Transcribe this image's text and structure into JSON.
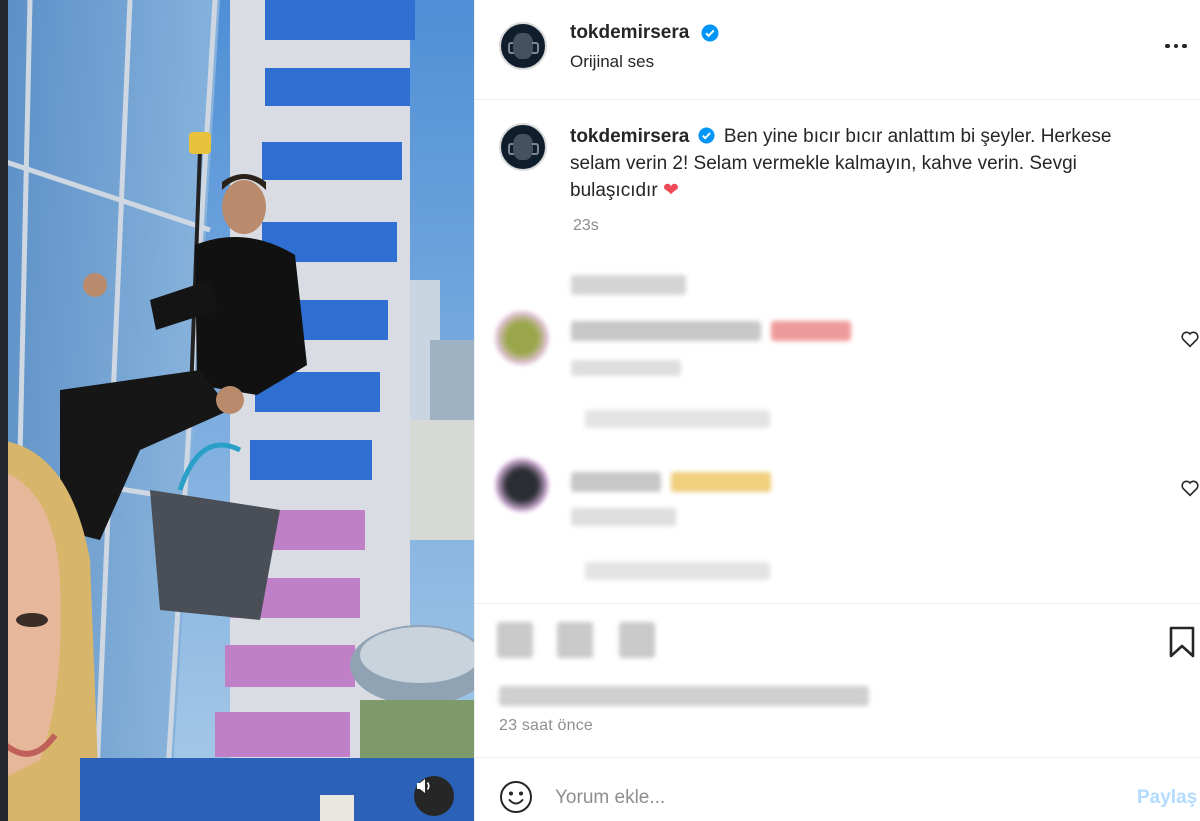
{
  "post": {
    "author": "tokdemirsera",
    "audio": "Orijinal ses",
    "more_icon": "more-horizontal-icon",
    "verified_icon": "verified-badge-icon",
    "colors": {
      "verified": "#0095f6",
      "accent": "#ed4956",
      "muted": "#8e8e8e",
      "share_disabled": "#b3dbff"
    }
  },
  "caption": {
    "author": "tokdemirsera",
    "text": "Ben yine bıcır bıcır anlattım bi şeyler. Herkese selam verin 2! Selam vermekle kalmayın, kahve verin. Sevgi bulaşıcıdır",
    "emoji": "❤",
    "age": "23s"
  },
  "comments": [
    {
      "avatar_icon": "blurred-avatar",
      "like_icon": "heart-outline-icon"
    },
    {
      "avatar_icon": "blurred-avatar",
      "like_icon": "heart-outline-icon"
    }
  ],
  "footer": {
    "posted": "23 saat önce",
    "bookmark_icon": "bookmark-icon"
  },
  "composer": {
    "emoji_icon": "smiley-icon",
    "placeholder": "Yorum ekle...",
    "share_label": "Paylaş"
  },
  "media": {
    "sound_icon": "speaker-icon"
  }
}
